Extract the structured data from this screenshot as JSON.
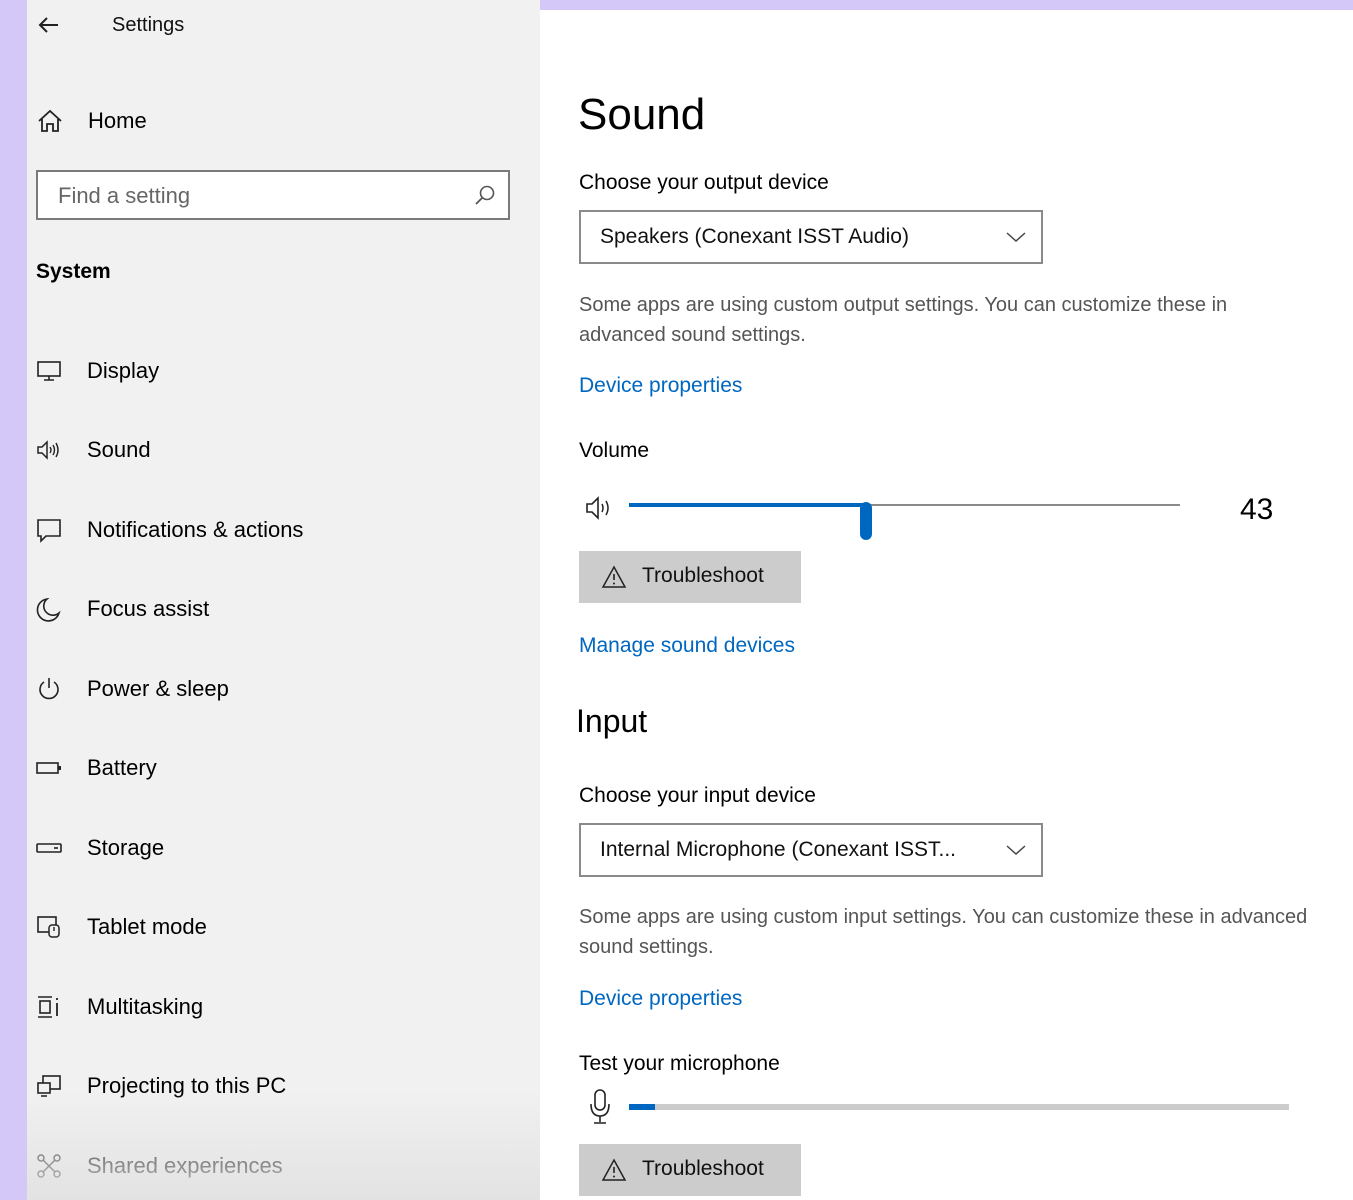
{
  "window": {
    "title": "Settings"
  },
  "sidebar": {
    "home_label": "Home",
    "search_placeholder": "Find a setting",
    "section_label": "System",
    "items": [
      {
        "label": "Display",
        "icon": "monitor-icon"
      },
      {
        "label": "Sound",
        "icon": "speaker-icon"
      },
      {
        "label": "Notifications & actions",
        "icon": "notification-icon"
      },
      {
        "label": "Focus assist",
        "icon": "moon-icon"
      },
      {
        "label": "Power & sleep",
        "icon": "power-icon"
      },
      {
        "label": "Battery",
        "icon": "battery-icon"
      },
      {
        "label": "Storage",
        "icon": "storage-icon"
      },
      {
        "label": "Tablet mode",
        "icon": "tablet-mode-icon"
      },
      {
        "label": "Multitasking",
        "icon": "multitasking-icon"
      },
      {
        "label": "Projecting to this PC",
        "icon": "projecting-icon"
      },
      {
        "label": "Shared experiences",
        "icon": "shared-experiences-icon"
      }
    ]
  },
  "main": {
    "title": "Sound",
    "output": {
      "label": "Choose your output device",
      "selected": "Speakers (Conexant ISST Audio)",
      "description": "Some apps are using custom output settings. You can customize these in advanced sound settings.",
      "device_properties": "Device properties",
      "volume_label": "Volume",
      "volume_value": "43",
      "volume_level": 43,
      "troubleshoot": "Troubleshoot",
      "manage_devices": "Manage sound devices"
    },
    "input": {
      "title": "Input",
      "label": "Choose your input device",
      "selected": "Internal Microphone (Conexant ISST...",
      "description": "Some apps are using custom input settings. You can customize these in advanced sound settings.",
      "device_properties": "Device properties",
      "test_label": "Test your microphone",
      "mic_level": 4,
      "troubleshoot": "Troubleshoot"
    }
  },
  "colors": {
    "accent": "#0067c0",
    "sidebar_bg": "#f1f1f1",
    "desktop_bg": "#d3c8f7"
  }
}
